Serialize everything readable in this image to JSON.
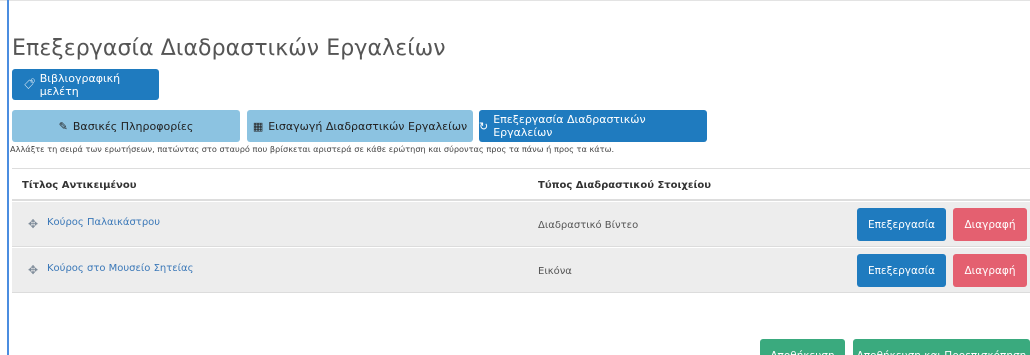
{
  "page": {
    "title": "Επεξεργασία Διαδραστικών Εργαλείων"
  },
  "tag": {
    "label": "Βιβλιογραφική μελέτη"
  },
  "steps": [
    {
      "label": "Βασικές Πληροφορίες",
      "icon": "pencil-icon",
      "active": false
    },
    {
      "label": "Εισαγωγή Διαδραστικών Εργαλείων",
      "icon": "sitemap-icon",
      "active": false
    },
    {
      "label": "Επεξεργασία Διαδραστικών Εργαλείων",
      "icon": "refresh-icon",
      "active": true
    }
  ],
  "help_text": "Αλλάξτε τη σειρά των ερωτήσεων, πατώντας στο σταυρό που βρίσκεται αριστερά σε κάθε ερώτηση και σύροντας προς τα πάνω ή προς τα κάτω.",
  "table": {
    "headers": [
      "Τίτλος Αντικειμένου",
      "Τύπος Διαδραστικού Στοιχείου"
    ],
    "rows": [
      {
        "title": "Κούρος Παλαικάστρου",
        "type": "Διαδραστικό Βίντεο",
        "edit": "Επεξεργασία",
        "delete": "Διαγραφή"
      },
      {
        "title": "Κούρος στο Μουσείο Σητείας",
        "type": "Εικόνα",
        "edit": "Επεξεργασία",
        "delete": "Διαγραφή"
      }
    ]
  },
  "actions": {
    "save": "Αποθήκευση",
    "save_preview": "Αποθήκευση και Προεπισκόπηση"
  },
  "colors": {
    "primary": "#1f7bbf",
    "primary_light": "#8cc3e1",
    "danger": "#e46070",
    "success": "#3aaa7e",
    "link": "#3b78b8"
  }
}
